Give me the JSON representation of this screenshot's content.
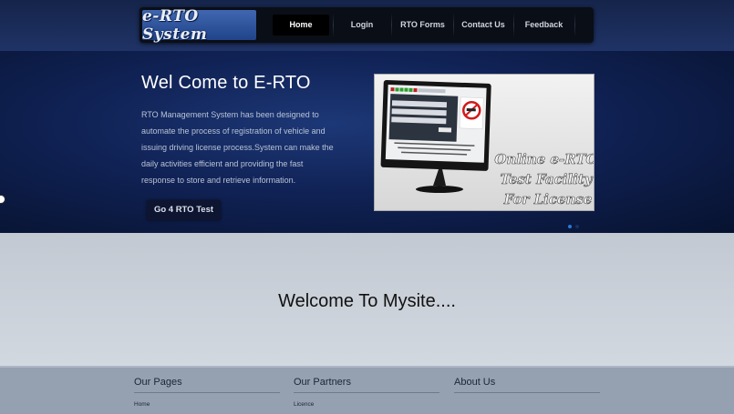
{
  "header": {
    "logo_text": "e-RTO System",
    "nav": [
      {
        "label": "Home",
        "active": true
      },
      {
        "label": "Login"
      },
      {
        "label": "RTO Forms"
      },
      {
        "label": "Contact Us"
      },
      {
        "label": "Feedback"
      }
    ]
  },
  "hero": {
    "title": "Wel Come to E-RTO",
    "description": "RTO Management System has been designed to automate the process of registration of vehicle and issuing driving license process.System can make the daily activities efficient and providing the fast response to store and retrieve information.",
    "button_label": "Go 4 RTO Test",
    "slide": {
      "caption_lines": [
        "Online e-RTO",
        "Test Facility",
        "For License"
      ]
    }
  },
  "welcome": {
    "text": "Welcome To Mysite...."
  },
  "footer": {
    "columns": [
      {
        "title": "Our Pages",
        "links": [
          "Home"
        ]
      },
      {
        "title": "Our Partners",
        "links": [
          "Licence"
        ]
      },
      {
        "title": "About Us",
        "links": []
      }
    ]
  },
  "colors": {
    "header_bg": "#15244a",
    "hero_bg": "#102255",
    "welcome_bg": "#c9cfd8",
    "footer_bg": "#95a0b0",
    "logo_bg": "#2f559d"
  }
}
